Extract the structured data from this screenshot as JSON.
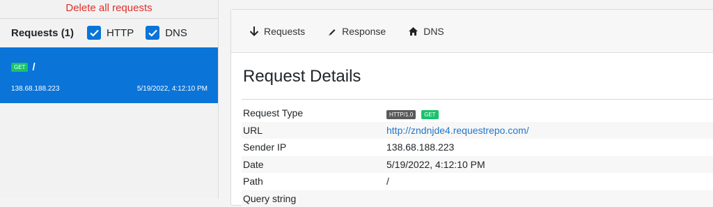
{
  "sidebar": {
    "delete_all_label": "Delete all requests",
    "requests_title": "Requests (1)",
    "filters": [
      {
        "label": "HTTP",
        "checked": true
      },
      {
        "label": "DNS",
        "checked": true
      }
    ],
    "requests": [
      {
        "method": "GET",
        "path": "/",
        "ip": "138.68.188.223",
        "date": "5/19/2022, 4:12:10 PM",
        "selected": true
      }
    ]
  },
  "tabs": [
    {
      "label": "Requests",
      "icon": "arrow-down-icon"
    },
    {
      "label": "Response",
      "icon": "pencil-icon"
    },
    {
      "label": "DNS",
      "icon": "home-icon"
    }
  ],
  "details": {
    "title": "Request Details",
    "rows": [
      {
        "key": "Request Type",
        "value": ""
      },
      {
        "key": "URL",
        "value": "http://zndnjde4.requestrepo.com/"
      },
      {
        "key": "Sender IP",
        "value": "138.68.188.223"
      },
      {
        "key": "Date",
        "value": "5/19/2022, 4:12:10 PM"
      },
      {
        "key": "Path",
        "value": "/"
      },
      {
        "key": "Query string",
        "value": ""
      }
    ],
    "request_type_badges": {
      "protocol": "HTTP/1.0",
      "method": "GET"
    }
  },
  "colors": {
    "accent": "#0a74d8",
    "danger": "#e0302a",
    "get_badge": "#19c26b",
    "protocol_badge": "#5a5a5a",
    "link": "#2277cc"
  }
}
